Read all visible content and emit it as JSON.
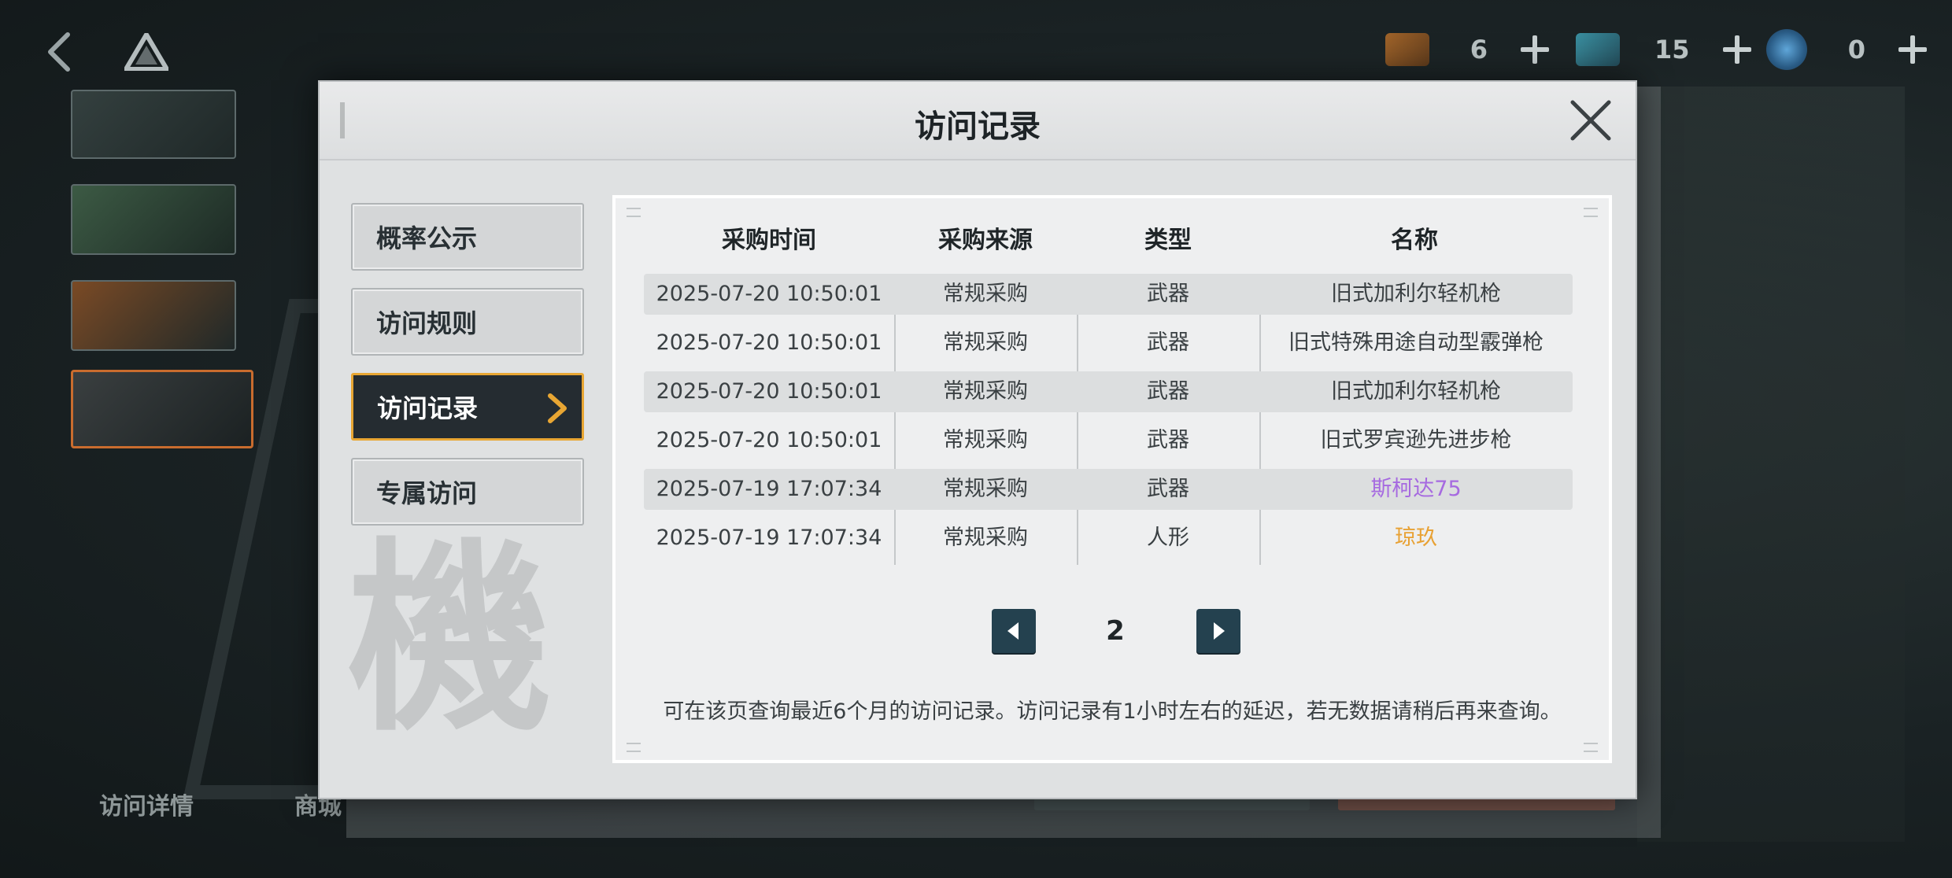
{
  "top_bar": {
    "currencies": [
      {
        "icon": "ticket-icon",
        "amount": "6"
      },
      {
        "icon": "crystal-icon",
        "amount": "15"
      },
      {
        "icon": "coin-icon",
        "amount": "0"
      }
    ]
  },
  "bottom_tabs": [
    "访问详情",
    "商城"
  ],
  "modal": {
    "title": "访问记录",
    "menu": [
      {
        "label": "概率公示",
        "active": false
      },
      {
        "label": "访问规则",
        "active": false
      },
      {
        "label": "访问记录",
        "active": true
      },
      {
        "label": "专属访问",
        "active": false
      }
    ],
    "table": {
      "headers": [
        "采购时间",
        "采购来源",
        "类型",
        "名称"
      ],
      "rows": [
        {
          "time": "2025-07-20 10:50:01",
          "source": "常规采购",
          "type": "武器",
          "name": "旧式加利尔轻机枪",
          "name_color": "#3a4043"
        },
        {
          "time": "2025-07-20 10:50:01",
          "source": "常规采购",
          "type": "武器",
          "name": "旧式特殊用途自动型霰弹枪",
          "name_color": "#3a4043"
        },
        {
          "time": "2025-07-20 10:50:01",
          "source": "常规采购",
          "type": "武器",
          "name": "旧式加利尔轻机枪",
          "name_color": "#3a4043"
        },
        {
          "time": "2025-07-20 10:50:01",
          "source": "常规采购",
          "type": "武器",
          "name": "旧式罗宾逊先进步枪",
          "name_color": "#3a4043"
        },
        {
          "time": "2025-07-19 17:07:34",
          "source": "常规采购",
          "type": "武器",
          "name": "斯柯达75",
          "name_color": "#a66ae0"
        },
        {
          "time": "2025-07-19 17:07:34",
          "source": "常规采购",
          "type": "人形",
          "name": "琼玖",
          "name_color": "#e8a133"
        }
      ]
    },
    "pagination": {
      "page": "2"
    },
    "note": "可在该页查询最近6个月的访问记录。访问记录有1小时左右的延迟，若无数据请稍后再来查询。",
    "watermark": "機"
  },
  "colors": {
    "accent": "#e8a633",
    "active_menu_bg": "#252c31",
    "page_button": "#24414f",
    "rarity_purple": "#a66ae0",
    "rarity_orange": "#e8a133"
  }
}
